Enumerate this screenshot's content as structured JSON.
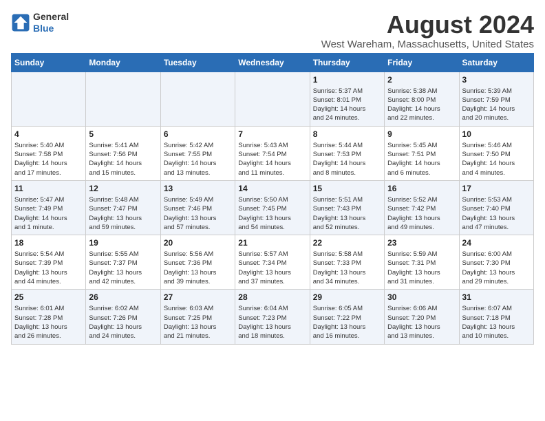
{
  "header": {
    "logo_line1": "General",
    "logo_line2": "Blue",
    "title": "August 2024",
    "subtitle": "West Wareham, Massachusetts, United States"
  },
  "days_of_week": [
    "Sunday",
    "Monday",
    "Tuesday",
    "Wednesday",
    "Thursday",
    "Friday",
    "Saturday"
  ],
  "weeks": [
    [
      {
        "day": "",
        "details": ""
      },
      {
        "day": "",
        "details": ""
      },
      {
        "day": "",
        "details": ""
      },
      {
        "day": "",
        "details": ""
      },
      {
        "day": "1",
        "details": "Sunrise: 5:37 AM\nSunset: 8:01 PM\nDaylight: 14 hours\nand 24 minutes."
      },
      {
        "day": "2",
        "details": "Sunrise: 5:38 AM\nSunset: 8:00 PM\nDaylight: 14 hours\nand 22 minutes."
      },
      {
        "day": "3",
        "details": "Sunrise: 5:39 AM\nSunset: 7:59 PM\nDaylight: 14 hours\nand 20 minutes."
      }
    ],
    [
      {
        "day": "4",
        "details": "Sunrise: 5:40 AM\nSunset: 7:58 PM\nDaylight: 14 hours\nand 17 minutes."
      },
      {
        "day": "5",
        "details": "Sunrise: 5:41 AM\nSunset: 7:56 PM\nDaylight: 14 hours\nand 15 minutes."
      },
      {
        "day": "6",
        "details": "Sunrise: 5:42 AM\nSunset: 7:55 PM\nDaylight: 14 hours\nand 13 minutes."
      },
      {
        "day": "7",
        "details": "Sunrise: 5:43 AM\nSunset: 7:54 PM\nDaylight: 14 hours\nand 11 minutes."
      },
      {
        "day": "8",
        "details": "Sunrise: 5:44 AM\nSunset: 7:53 PM\nDaylight: 14 hours\nand 8 minutes."
      },
      {
        "day": "9",
        "details": "Sunrise: 5:45 AM\nSunset: 7:51 PM\nDaylight: 14 hours\nand 6 minutes."
      },
      {
        "day": "10",
        "details": "Sunrise: 5:46 AM\nSunset: 7:50 PM\nDaylight: 14 hours\nand 4 minutes."
      }
    ],
    [
      {
        "day": "11",
        "details": "Sunrise: 5:47 AM\nSunset: 7:49 PM\nDaylight: 14 hours\nand 1 minute."
      },
      {
        "day": "12",
        "details": "Sunrise: 5:48 AM\nSunset: 7:47 PM\nDaylight: 13 hours\nand 59 minutes."
      },
      {
        "day": "13",
        "details": "Sunrise: 5:49 AM\nSunset: 7:46 PM\nDaylight: 13 hours\nand 57 minutes."
      },
      {
        "day": "14",
        "details": "Sunrise: 5:50 AM\nSunset: 7:45 PM\nDaylight: 13 hours\nand 54 minutes."
      },
      {
        "day": "15",
        "details": "Sunrise: 5:51 AM\nSunset: 7:43 PM\nDaylight: 13 hours\nand 52 minutes."
      },
      {
        "day": "16",
        "details": "Sunrise: 5:52 AM\nSunset: 7:42 PM\nDaylight: 13 hours\nand 49 minutes."
      },
      {
        "day": "17",
        "details": "Sunrise: 5:53 AM\nSunset: 7:40 PM\nDaylight: 13 hours\nand 47 minutes."
      }
    ],
    [
      {
        "day": "18",
        "details": "Sunrise: 5:54 AM\nSunset: 7:39 PM\nDaylight: 13 hours\nand 44 minutes."
      },
      {
        "day": "19",
        "details": "Sunrise: 5:55 AM\nSunset: 7:37 PM\nDaylight: 13 hours\nand 42 minutes."
      },
      {
        "day": "20",
        "details": "Sunrise: 5:56 AM\nSunset: 7:36 PM\nDaylight: 13 hours\nand 39 minutes."
      },
      {
        "day": "21",
        "details": "Sunrise: 5:57 AM\nSunset: 7:34 PM\nDaylight: 13 hours\nand 37 minutes."
      },
      {
        "day": "22",
        "details": "Sunrise: 5:58 AM\nSunset: 7:33 PM\nDaylight: 13 hours\nand 34 minutes."
      },
      {
        "day": "23",
        "details": "Sunrise: 5:59 AM\nSunset: 7:31 PM\nDaylight: 13 hours\nand 31 minutes."
      },
      {
        "day": "24",
        "details": "Sunrise: 6:00 AM\nSunset: 7:30 PM\nDaylight: 13 hours\nand 29 minutes."
      }
    ],
    [
      {
        "day": "25",
        "details": "Sunrise: 6:01 AM\nSunset: 7:28 PM\nDaylight: 13 hours\nand 26 minutes."
      },
      {
        "day": "26",
        "details": "Sunrise: 6:02 AM\nSunset: 7:26 PM\nDaylight: 13 hours\nand 24 minutes."
      },
      {
        "day": "27",
        "details": "Sunrise: 6:03 AM\nSunset: 7:25 PM\nDaylight: 13 hours\nand 21 minutes."
      },
      {
        "day": "28",
        "details": "Sunrise: 6:04 AM\nSunset: 7:23 PM\nDaylight: 13 hours\nand 18 minutes."
      },
      {
        "day": "29",
        "details": "Sunrise: 6:05 AM\nSunset: 7:22 PM\nDaylight: 13 hours\nand 16 minutes."
      },
      {
        "day": "30",
        "details": "Sunrise: 6:06 AM\nSunset: 7:20 PM\nDaylight: 13 hours\nand 13 minutes."
      },
      {
        "day": "31",
        "details": "Sunrise: 6:07 AM\nSunset: 7:18 PM\nDaylight: 13 hours\nand 10 minutes."
      }
    ]
  ]
}
